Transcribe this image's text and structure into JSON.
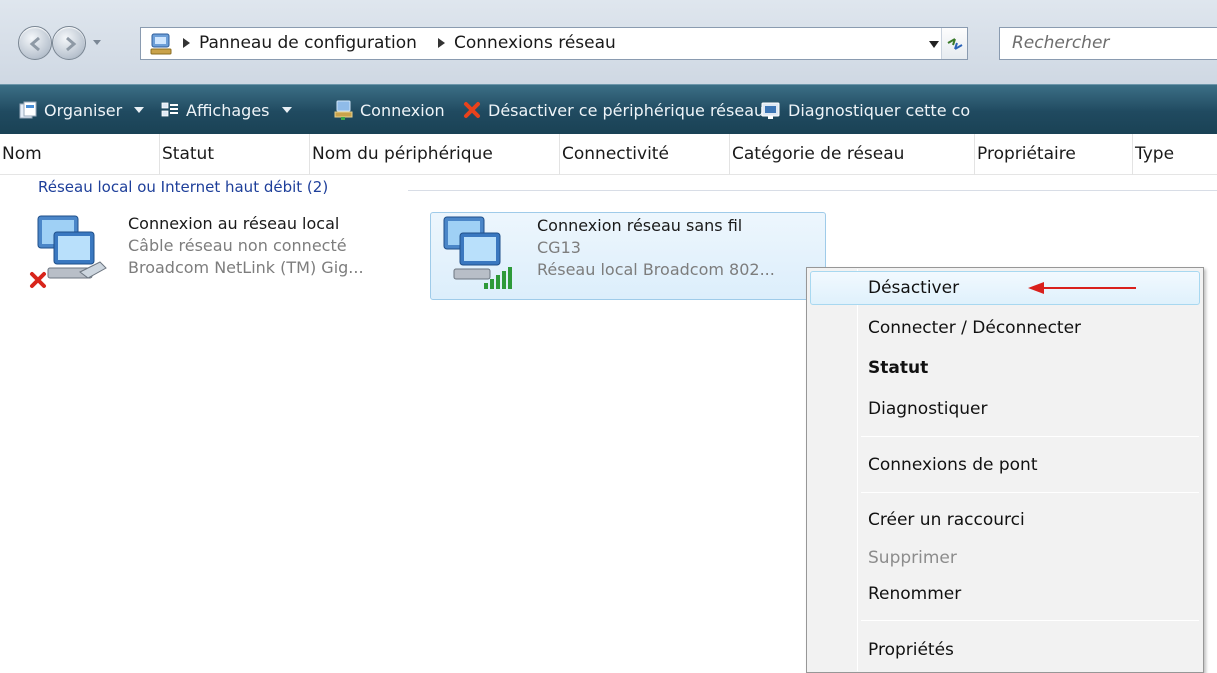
{
  "address_bar": {
    "breadcrumbs": [
      "Panneau de configuration",
      "Connexions réseau"
    ],
    "search_placeholder": "Rechercher"
  },
  "toolbar": {
    "organize": "Organiser",
    "views": "Affichages",
    "connect": "Connexion",
    "disable": "Désactiver ce périphérique réseau",
    "diagnose": "Diagnostiquer cette co"
  },
  "columns": [
    "Nom",
    "Statut",
    "Nom du périphérique",
    "Connectivité",
    "Catégorie de réseau",
    "Propriétaire",
    "Type"
  ],
  "group": {
    "label": "Réseau local ou Internet haut débit (2)"
  },
  "connections": [
    {
      "name": "Connexion au réseau local",
      "status": "Câble réseau non connecté",
      "device": "Broadcom NetLink (TM) Gig...",
      "icon": "wired-network-icon"
    },
    {
      "name": "Connexion réseau sans fil",
      "status": "CG13",
      "device": "Réseau local Broadcom 802...",
      "icon": "wireless-network-icon"
    }
  ],
  "context_menu": {
    "items": [
      "Désactiver",
      "Connecter / Déconnecter",
      "Statut",
      "Diagnostiquer",
      "Connexions de pont",
      "Créer un raccourci",
      "Supprimer",
      "Renommer",
      "Propriétés"
    ],
    "highlighted": "Désactiver",
    "bold": "Statut",
    "disabled": "Supprimer"
  },
  "colors": {
    "toolbar_bg": "#204a60",
    "group_text": "#1e3f9a",
    "annotation_arrow": "#d9201c"
  }
}
